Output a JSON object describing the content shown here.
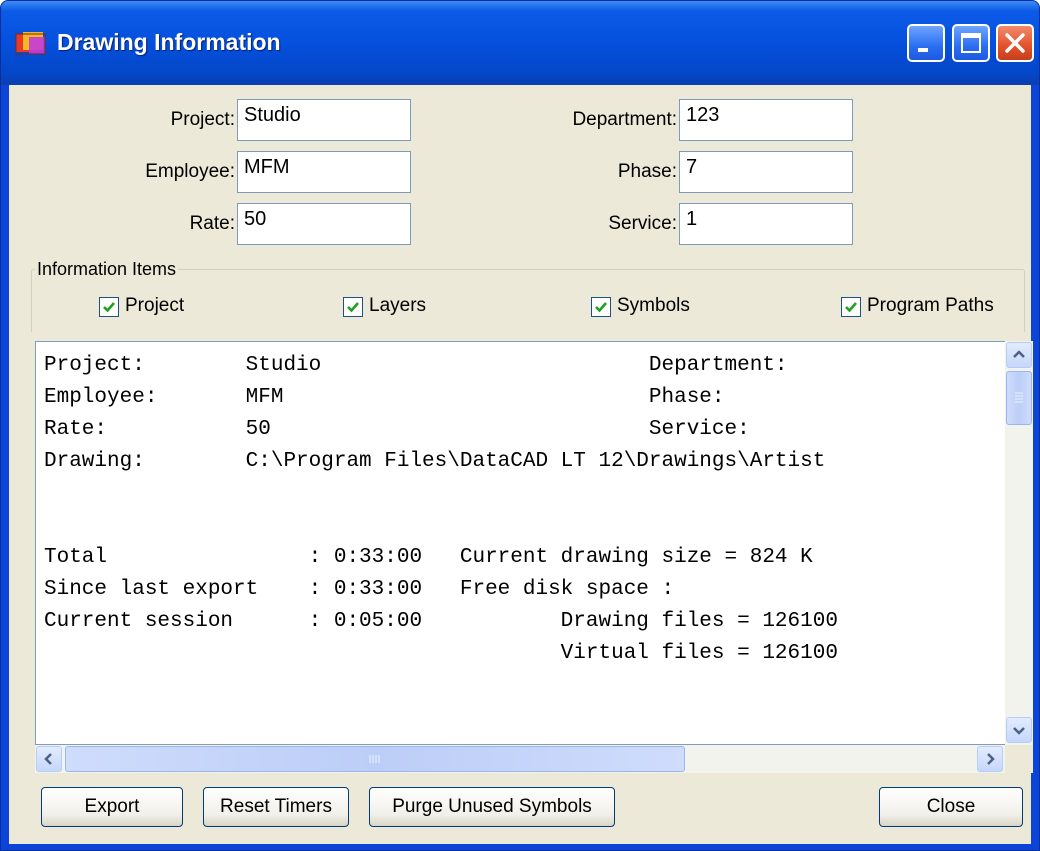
{
  "window": {
    "title": "Drawing Information",
    "icon": "drawing-info-app-icon"
  },
  "fields": {
    "project": {
      "label": "Project:",
      "value": "Studio"
    },
    "employee": {
      "label": "Employee:",
      "value": "MFM"
    },
    "rate": {
      "label": "Rate:",
      "value": "50"
    },
    "department": {
      "label": "Department:",
      "value": "123"
    },
    "phase": {
      "label": "Phase:",
      "value": "7"
    },
    "service": {
      "label": "Service:",
      "value": "1"
    }
  },
  "info_items": {
    "title": "Information Items",
    "project": {
      "label": "Project",
      "checked": true
    },
    "layers": {
      "label": "Layers",
      "checked": true
    },
    "symbols": {
      "label": "Symbols",
      "checked": true
    },
    "program_paths": {
      "label": "Program Paths",
      "checked": true
    }
  },
  "report_lines": [
    "Project:        Studio                          Department:",
    "Employee:       MFM                             Phase:",
    "Rate:           50                              Service:",
    "Drawing:        C:\\Program Files\\DataCAD LT 12\\Drawings\\Artist",
    "",
    "",
    "Total                : 0:33:00   Current drawing size = 824 K",
    "Since last export    : 0:33:00   Free disk space :",
    "Current session      : 0:05:00           Drawing files = 126100",
    "                                         Virtual files = 126100"
  ],
  "buttons": {
    "export": "Export",
    "reset_timers": "Reset Timers",
    "purge": "Purge Unused Symbols",
    "close": "Close"
  },
  "colors": {
    "titlebar": "#0550dd",
    "dialog_bg": "#ece9d8",
    "close_button": "#e2512a"
  }
}
